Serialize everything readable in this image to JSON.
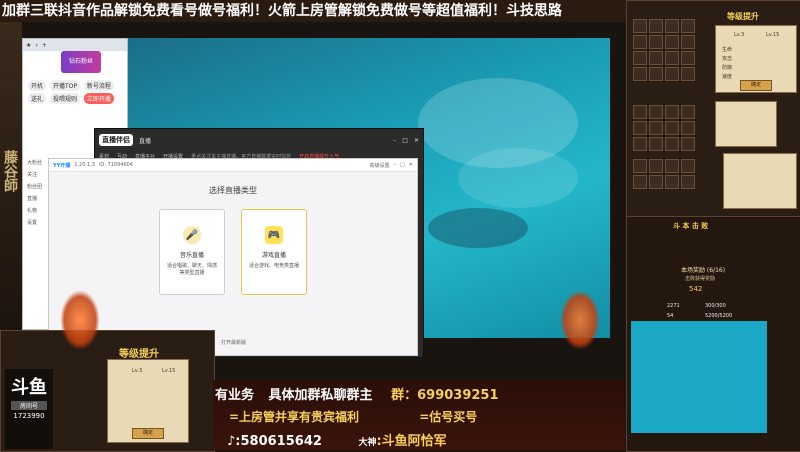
{
  "banner": {
    "text": "加群三联抖音作品解锁免费看号做号福利！火箭上房管解锁免费做号等超值福利！斗技思路"
  },
  "left_strip": {
    "text": "藤谷師"
  },
  "browser": {
    "tab_icons": [
      "star-icon",
      "chevron-icon",
      "plus-icon"
    ],
    "avatar_label": "钻石粉丝",
    "pills": [
      "开机",
      "开播TOP",
      "新号流程",
      "送礼",
      "投喂规则"
    ],
    "red_pill": "立即开播",
    "rows": [
      "大粉丝",
      "关注",
      "粉丝团",
      "直播",
      "礼物",
      "设置"
    ]
  },
  "app": {
    "logo": "直播伴侣",
    "tab": "直播",
    "menu": [
      "素材",
      "互动",
      "直播平台",
      "开播设置"
    ],
    "notice": "重点关注本主播直播，官方直播数据实时监控",
    "live_text": "开启直播提升人气",
    "window_icons": [
      "minimize-icon",
      "maximize-icon",
      "close-icon"
    ]
  },
  "dialog": {
    "header_left": "YY开播",
    "header_version": "1.20.1.3",
    "header_id": "ID: 71094604",
    "header_right": "高级设置",
    "title": "选择直播类型",
    "cards": [
      {
        "name": "音乐直播",
        "desc": "适合唱歌、聊天、情感等类型直播",
        "selected": false
      },
      {
        "name": "游戏直播",
        "desc": "适合游戏、电竞类直播",
        "selected": true
      }
    ],
    "footer": "打开最新版"
  },
  "right_panels": {
    "level_title": "等级提升",
    "level_from": "Lv.3",
    "level_to": "Lv.15",
    "stats": [
      "生命",
      "攻击",
      "防御",
      "速度"
    ],
    "btn": "确定",
    "boss_title": "斗 本 击 败",
    "reward_title": "本场奖励 (6/16)",
    "reward_sub": "击败获得奖励",
    "gold1": "2271",
    "gold2": "300/300",
    "gold3": "54",
    "gold4": "5200/5200",
    "flag": "542"
  },
  "bottom_left": {
    "title": "等级提升",
    "douyu": "斗鱼",
    "room_label": "房间号",
    "room_id": "1723990",
    "level_from": "Lv.3",
    "level_to": "Lv.15",
    "btn": "确定"
  },
  "promo": {
    "line1_left": "有业务",
    "line1_mid": "具体加群私聊群主",
    "line1_right_label": "群：",
    "line1_right_num": "699039251",
    "line2_left": "=上房管并享有贵宾福利",
    "line2_right": "=估号买号",
    "line3_left": ":580615642",
    "line3_right_label": "大神",
    "line3_right": ":斗鱼阿恰军"
  },
  "colors": {
    "accent_gold": "#f7cf5a",
    "water": "#1aa0b8",
    "selected_card_border": "#e6c94a"
  }
}
